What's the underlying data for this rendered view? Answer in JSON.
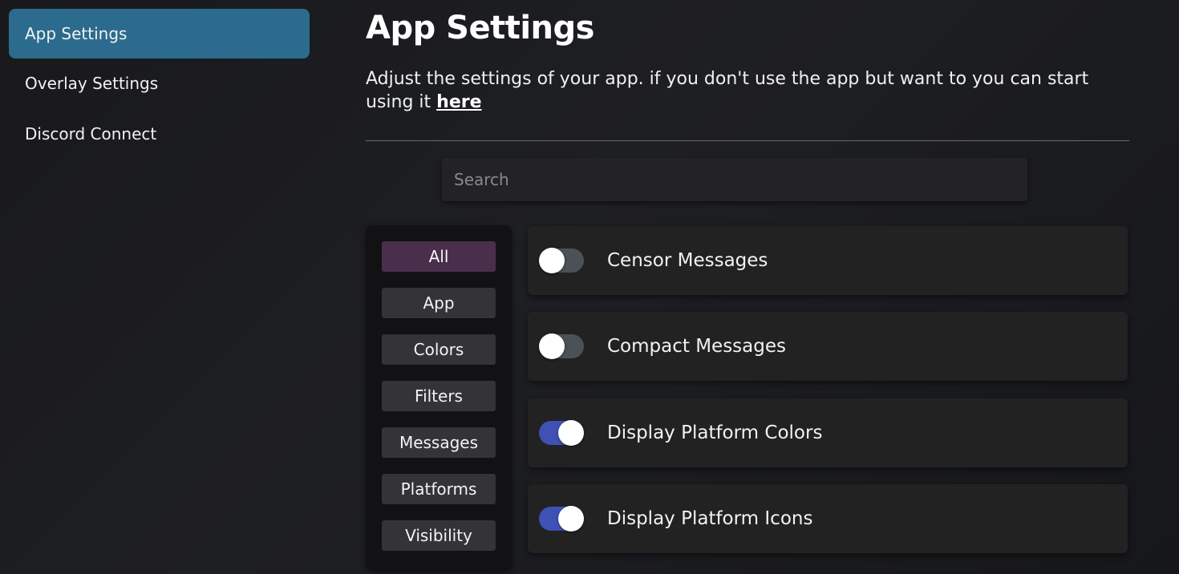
{
  "sidebar": {
    "items": [
      {
        "label": "App Settings",
        "active": true
      },
      {
        "label": "Overlay Settings",
        "active": false
      },
      {
        "label": "Discord Connect",
        "active": false
      }
    ]
  },
  "header": {
    "title": "App Settings",
    "description": "Adjust the settings of your app. if you don't use the app but want to you can start using it ",
    "link_label": "here"
  },
  "search": {
    "placeholder": "Search",
    "value": ""
  },
  "filters": {
    "items": [
      {
        "label": "All",
        "active": true
      },
      {
        "label": "App",
        "active": false
      },
      {
        "label": "Colors",
        "active": false
      },
      {
        "label": "Filters",
        "active": false
      },
      {
        "label": "Messages",
        "active": false
      },
      {
        "label": "Platforms",
        "active": false
      },
      {
        "label": "Visibility",
        "active": false
      }
    ]
  },
  "settings": [
    {
      "label": "Censor Messages",
      "enabled": false
    },
    {
      "label": "Compact Messages",
      "enabled": false
    },
    {
      "label": "Display Platform Colors",
      "enabled": true
    },
    {
      "label": "Display Platform Icons",
      "enabled": true
    }
  ],
  "colors": {
    "active_nav": "#2b6b8e",
    "active_filter": "#4a2f4c",
    "toggle_on": "#3f51b5",
    "toggle_off": "#4b5157"
  }
}
